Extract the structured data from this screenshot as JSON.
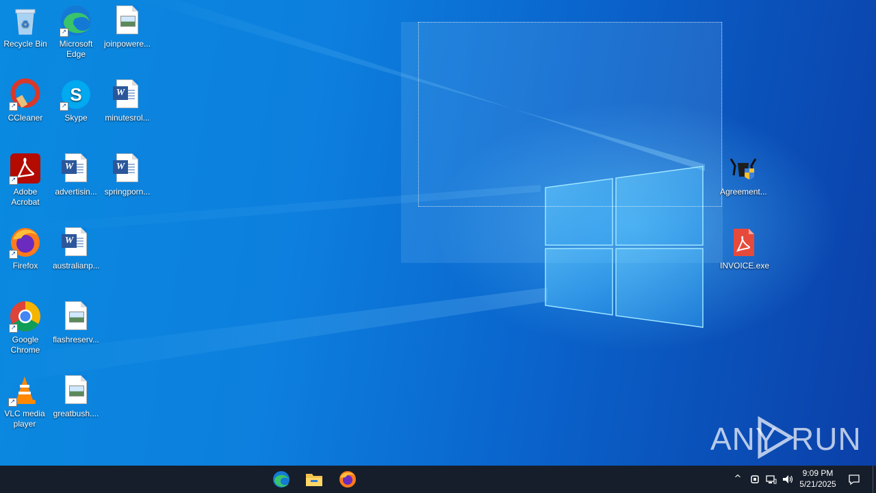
{
  "desktop": {
    "icons": [
      {
        "label": "Recycle Bin"
      },
      {
        "label": "Microsoft Edge"
      },
      {
        "label": "joinpowere..."
      },
      {
        "label": "CCleaner"
      },
      {
        "label": "Skype"
      },
      {
        "label": "minutesrol..."
      },
      {
        "label": "Adobe Acrobat"
      },
      {
        "label": "advertisin..."
      },
      {
        "label": "springporn..."
      },
      {
        "label": "Firefox"
      },
      {
        "label": "australianp..."
      },
      {
        "label": "Google Chrome"
      },
      {
        "label": "flashreserv..."
      },
      {
        "label": "VLC media player"
      },
      {
        "label": "greatbush...."
      },
      {
        "label": "Agreement..."
      },
      {
        "label": "INVOICE.exe"
      }
    ]
  },
  "watermark": {
    "left": "ANY",
    "right": "RUN"
  },
  "taskbar": {
    "pinned": [
      {
        "icon": "edge-icon"
      },
      {
        "icon": "file-explorer-icon"
      },
      {
        "icon": "firefox-icon"
      }
    ],
    "tray": {
      "chevron": "^",
      "time": "9:09 PM",
      "date": "5/21/2025"
    }
  },
  "colors": {
    "taskbar": "#161e2b",
    "desktop_accent": "#0a8ae0"
  }
}
